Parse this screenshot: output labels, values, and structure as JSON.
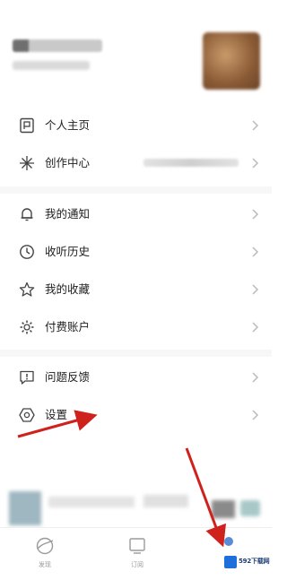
{
  "profile": {
    "name_blurred": "",
    "avatar_desc": "blurred-avatar"
  },
  "menu": {
    "items": [
      {
        "label": "个人主页",
        "icon": "profile-page-icon"
      },
      {
        "label": "创作中心",
        "icon": "sparkle-icon"
      },
      {
        "label": "我的通知",
        "icon": "bell-icon"
      },
      {
        "label": "收听历史",
        "icon": "clock-icon"
      },
      {
        "label": "我的收藏",
        "icon": "star-icon"
      },
      {
        "label": "付费账户",
        "icon": "gear-icon"
      },
      {
        "label": "问题反馈",
        "icon": "feedback-icon"
      },
      {
        "label": "设置",
        "icon": "settings-hexagon-icon"
      }
    ]
  },
  "tabs": [
    {
      "label": "发现",
      "icon": "discover-icon"
    },
    {
      "label": "订阅",
      "icon": "subscribe-icon"
    }
  ],
  "watermark": {
    "text": "592下载网"
  },
  "colors": {
    "arrow": "#d0221c",
    "icon_stroke": "#444444",
    "chevron": "#bbbbbb"
  }
}
